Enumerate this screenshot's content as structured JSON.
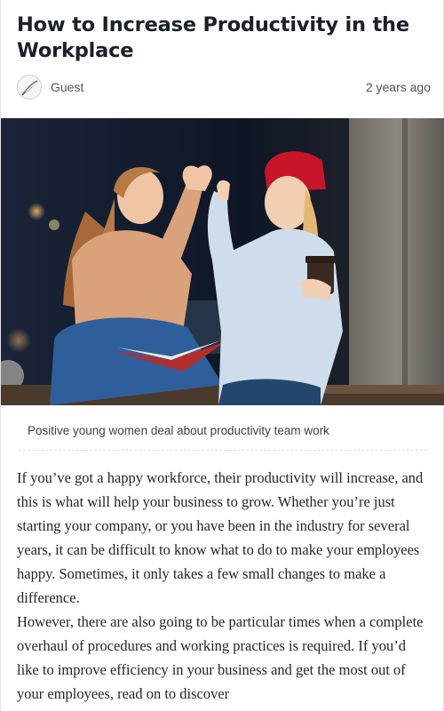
{
  "article": {
    "title": "How to Increase Productivity in the Workplace",
    "author": "Guest",
    "time_ago": "2 years ago",
    "image_caption": "Positive young women deal about productivity team work",
    "paragraphs": [
      "If you’ve got a happy workforce, their productivity will increase, and this is what will help your business to grow. Whether you’re just starting your company, or you have been in the industry for several years, it can be difficult to know what to do to make your employees happy. Sometimes, it only takes a few small changes to make a difference.",
      "However, there are also going to be particular times when a complete overhaul of procedures and working practices is required. If you’d like to improve efficiency in your business and get the most out of your employees, read on to discover"
    ]
  },
  "icons": {
    "avatar": "feather-avatar-icon"
  }
}
